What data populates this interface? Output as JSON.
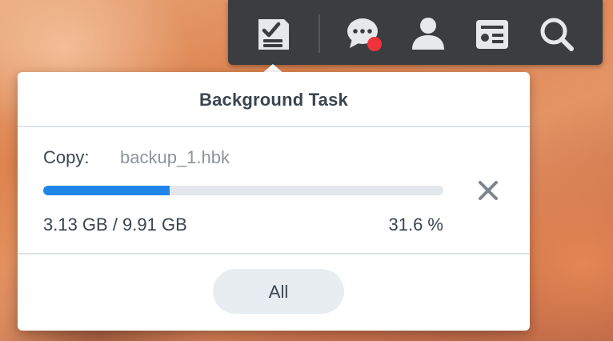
{
  "taskbar": {
    "icons": [
      "background-task-icon",
      "notification-chat-icon",
      "user-icon",
      "widgets-icon",
      "search-icon"
    ],
    "notification_badge_color": "#f2333d",
    "background_color": "#3b3d40"
  },
  "popup": {
    "title": "Background Task",
    "task": {
      "label": "Copy:",
      "filename": "backup_1.hbk",
      "size_text": "3.13 GB / 9.91 GB",
      "percent_text": "31.6 %",
      "progress_fraction": 0.316,
      "progress_color": "#1f86e8"
    },
    "all_button_label": "All"
  }
}
